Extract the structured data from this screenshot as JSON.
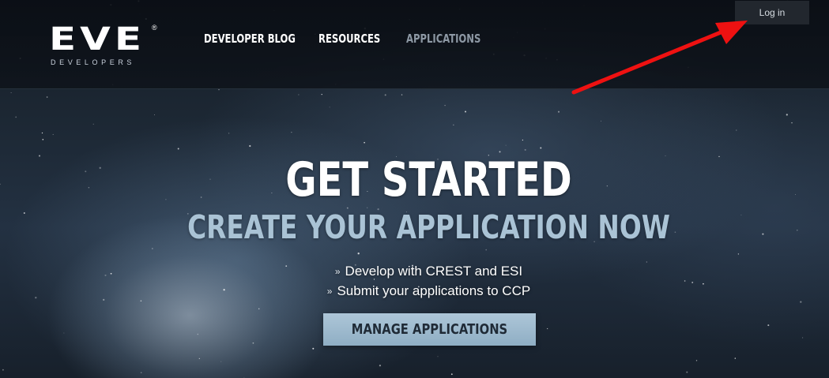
{
  "logo": {
    "wordmark": "EVE",
    "registered": "®",
    "subtitle": "DEVELOPERS"
  },
  "nav": {
    "items": [
      {
        "label": "DEVELOPER BLOG",
        "active": false
      },
      {
        "label": "RESOURCES",
        "active": false
      },
      {
        "label": "APPLICATIONS",
        "active": true
      }
    ]
  },
  "header": {
    "login_label": "Log in"
  },
  "hero": {
    "title": "GET STARTED",
    "subtitle": "CREATE YOUR APPLICATION NOW",
    "bullets": [
      {
        "marker": "»",
        "text": "Develop with CREST and ESI"
      },
      {
        "marker": "»",
        "text": "Submit your applications to CCP"
      }
    ],
    "cta_label": "MANAGE APPLICATIONS"
  },
  "colors": {
    "nav_active": "#8d98a4",
    "subtitle": "#aac3d5",
    "cta_background": "#9db8cc",
    "annotation_arrow": "#ee1111"
  },
  "annotation": {
    "arrow": "red arrow pointing to login button"
  }
}
